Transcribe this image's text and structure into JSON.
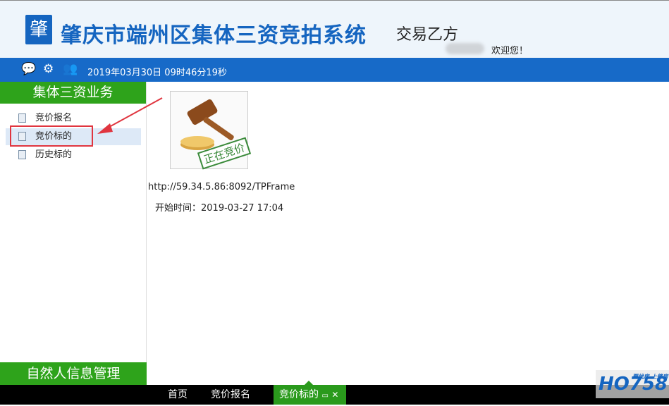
{
  "header": {
    "logo_text": "肇",
    "title": "肇庆市端州区集体三资竞拍系统",
    "subtitle": "交易乙方",
    "welcome": "欢迎您！"
  },
  "bar": {
    "icons": [
      "chat-icon",
      "gear-icon",
      "users-icon"
    ],
    "clock": "2019年03月30日 09时46分19秒"
  },
  "sidebar": {
    "section_title": "集体三资业务",
    "items": [
      {
        "label": "竞价报名"
      },
      {
        "label": "竞价标的"
      },
      {
        "label": "历史标的"
      }
    ],
    "bottom_title": "自然人信息管理"
  },
  "main": {
    "stamp": "正在竞价",
    "url": "http://59.34.5.86:8092/TPFrame",
    "start_time": "开始时间：2019-03-27 17:04"
  },
  "taskbar": {
    "tabs": [
      {
        "label": "首页"
      },
      {
        "label": "竞价报名"
      },
      {
        "label": "竞价标的"
      }
    ]
  },
  "watermark": {
    "text": "HO758",
    "slogan": "要找房 上肇房"
  }
}
